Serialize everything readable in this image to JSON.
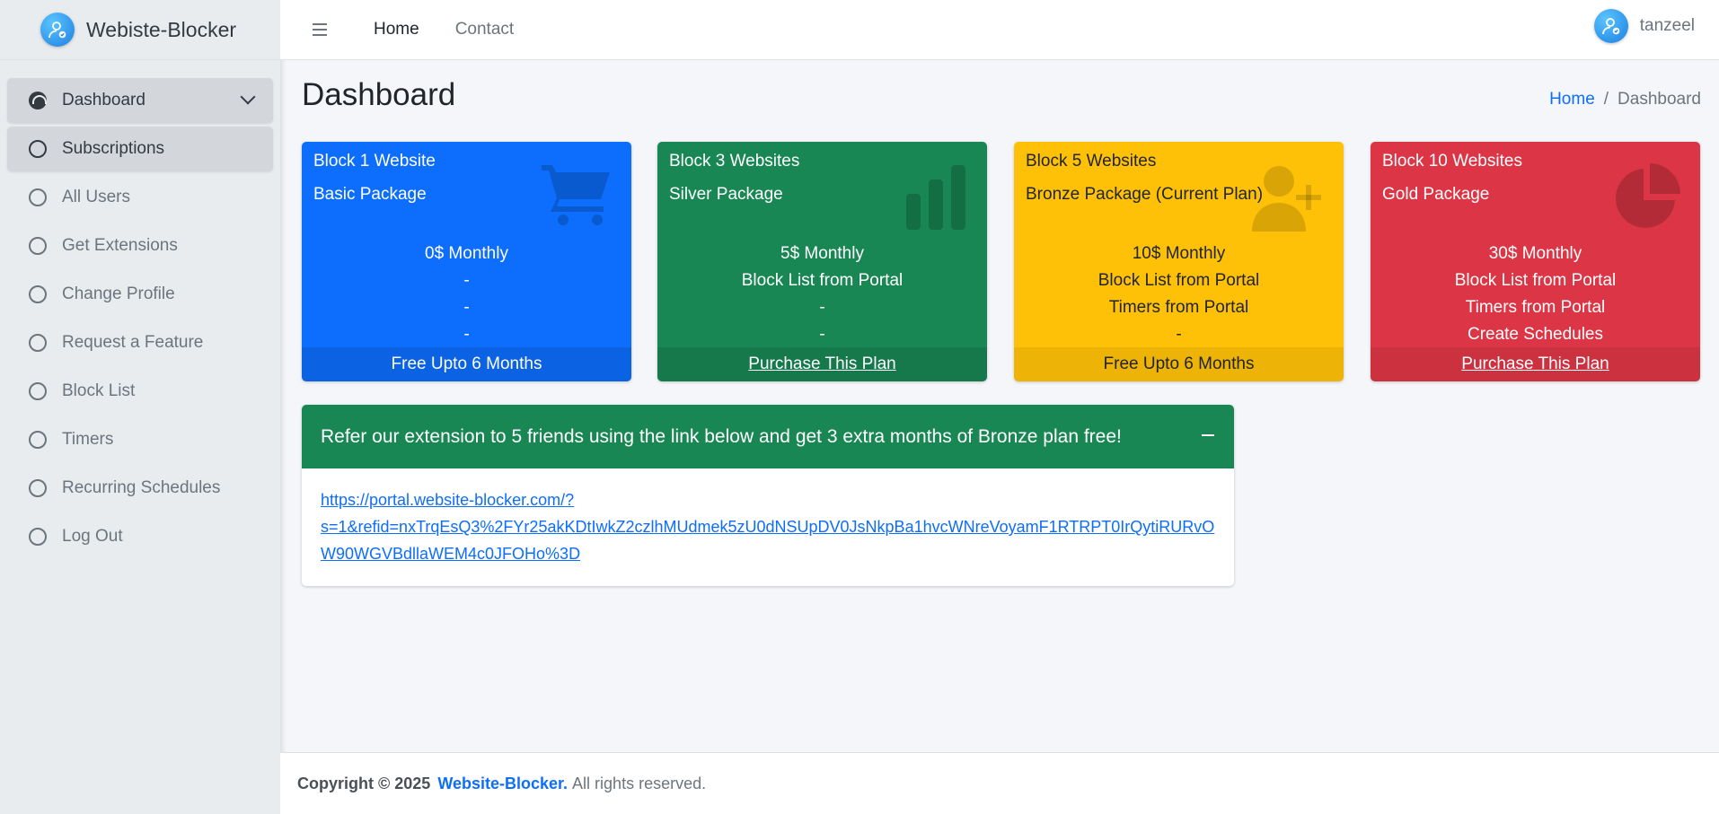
{
  "brand": {
    "name": "Webiste-Blocker"
  },
  "sidebar": {
    "items": [
      {
        "label": "Dashboard"
      },
      {
        "label": "Subscriptions"
      },
      {
        "label": "All Users"
      },
      {
        "label": "Get Extensions"
      },
      {
        "label": "Change Profile"
      },
      {
        "label": "Request a Feature"
      },
      {
        "label": "Block List"
      },
      {
        "label": "Timers"
      },
      {
        "label": "Recurring Schedules"
      },
      {
        "label": "Log Out"
      }
    ]
  },
  "topbar": {
    "home": "Home",
    "contact": "Contact",
    "username": "tanzeel"
  },
  "page": {
    "title": "Dashboard"
  },
  "breadcrumb": {
    "home": "Home",
    "separator": "/",
    "current": "Dashboard"
  },
  "plans": [
    {
      "title": "Block 1 Website",
      "package": "Basic Package",
      "features": [
        "0$ Monthly",
        "-",
        "-",
        "-"
      ],
      "footer": "Free Upto 6 Months",
      "icon": "cart-icon",
      "color": "#0d6efd"
    },
    {
      "title": "Block 3 Websites",
      "package": "Silver Package",
      "features": [
        "5$ Monthly",
        "Block List from Portal",
        "-",
        "-"
      ],
      "footer": "Purchase This Plan",
      "icon": "bar-chart-icon",
      "color": "#198754"
    },
    {
      "title": "Block 5 Websites",
      "package": "Bronze Package (Current Plan)",
      "features": [
        "10$ Monthly",
        "Block List from Portal",
        "Timers from Portal",
        "-"
      ],
      "footer": "Free Upto 6 Months",
      "icon": "user-plus-icon",
      "color": "#ffc107"
    },
    {
      "title": "Block 10 Websites",
      "package": "Gold Package",
      "features": [
        "30$ Monthly",
        "Block List from Portal",
        "Timers from Portal",
        "Create Schedules"
      ],
      "footer": "Purchase This Plan",
      "icon": "pie-chart-icon",
      "color": "#dc3545"
    }
  ],
  "referral": {
    "heading": "Refer our extension to 5 friends using the link below and get 3 extra months of Bronze plan free!",
    "link_line1": "https://portal.website-blocker.com/?",
    "link_line2": "s=1&refid=nxTrqEsQ3%2FYr25akKDtIwkZ2czlhMUdmek5zU0dNSUpDV0JsNkpBa1hvcWNreVoyamF1RTRPT0IrQytiRURvO",
    "link_line3": "W90WGVBdllaWEM4c0JFOHo%3D"
  },
  "footer": {
    "copyright": "Copyright © 2025",
    "brand": "Website-Blocker.",
    "rights": "All rights reserved."
  }
}
